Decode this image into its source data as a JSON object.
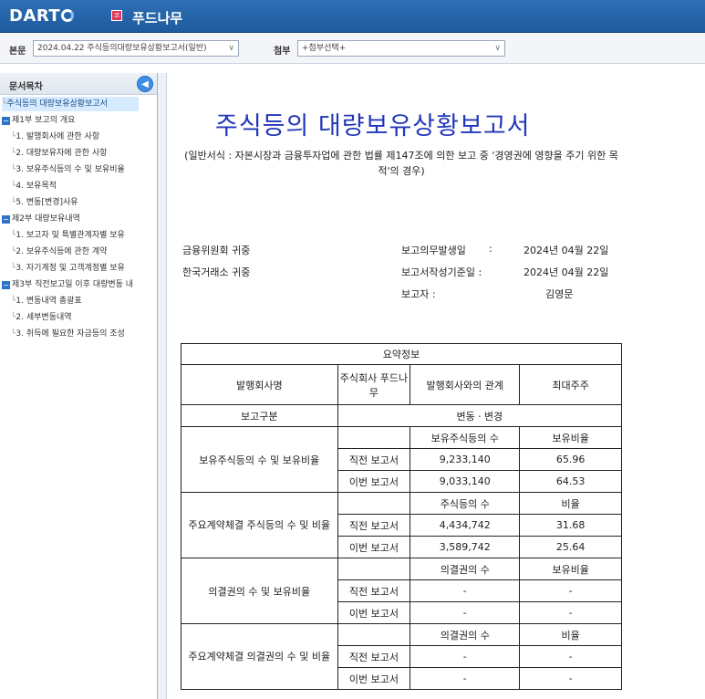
{
  "header": {
    "logo": "DART",
    "company_badge": "코",
    "company_name": "푸드나무"
  },
  "toolbar": {
    "main_label": "본문",
    "main_select": "2024.04.22  주식등의대량보유상황보고서(일반)",
    "attach_label": "첨부",
    "attach_select": "+첨부선택+"
  },
  "toc": {
    "title": "문서목차",
    "items": [
      {
        "label": "주식등의 대량보유상황보고서",
        "level": 0,
        "selected": true
      },
      {
        "label": "제1부 보고의 개요",
        "level": 0,
        "group": true
      },
      {
        "label": "1. 발행회사에 관한 사항",
        "level": 1
      },
      {
        "label": "2. 대량보유자에 관한 사항",
        "level": 1
      },
      {
        "label": "3. 보유주식등의 수 및 보유비율",
        "level": 1
      },
      {
        "label": "4. 보유목적",
        "level": 1
      },
      {
        "label": "5. 변동[변경]사유",
        "level": 1
      },
      {
        "label": "제2부 대량보유내역",
        "level": 0,
        "group": true
      },
      {
        "label": "1. 보고자 및 특별관계자별 보유",
        "level": 1
      },
      {
        "label": "2. 보유주식등에 관한 계약",
        "level": 1
      },
      {
        "label": "3. 자기계정 및 고객계정별 보유",
        "level": 1
      },
      {
        "label": "제3부 직전보고일 이후 대량변동 내",
        "level": 0,
        "group": true
      },
      {
        "label": "1. 변동내역 총괄표",
        "level": 1
      },
      {
        "label": "2. 세부변동내역",
        "level": 1
      },
      {
        "label": "3. 취득에 필요한 자금등의 조성",
        "level": 1
      }
    ]
  },
  "doc": {
    "title": "주식등의 대량보유상황보고서",
    "subtitle": "(일반서식 : 자본시장과 금융투자업에 관한 법률 제147조에 의한 보고 중 '경영권에 영향을 주기 위한 목적'의 경우)",
    "to1": "금융위원회 귀중",
    "to2": "한국거래소 귀중",
    "obligation_label": "보고의무발생일",
    "obligation_colon": ":",
    "obligation_date": "2024년 04월 22일",
    "basis_label": "보고서작성기준일 :",
    "basis_date": "2024년 04월 22일",
    "reporter_label": "보고자 :",
    "reporter_name": "김영문"
  },
  "summary": {
    "title": "요약정보",
    "issuer_label": "발행회사명",
    "issuer_name": "주식회사 푸드나무",
    "relation_label": "발행회사와의 관계",
    "relation_value": "최대주주",
    "report_type_label": "보고구분",
    "report_type_value": "변동ㆍ변경",
    "sections": [
      {
        "name": "보유주식등의 수 및 보유비율",
        "col1": "보유주식등의 수",
        "col2": "보유비율",
        "prev_label": "직전 보고서",
        "prev1": "9,233,140",
        "prev2": "65.96",
        "curr_label": "이번 보고서",
        "curr1": "9,033,140",
        "curr2": "64.53"
      },
      {
        "name": "주요계약체결 주식등의 수 및 비율",
        "col1": "주식등의 수",
        "col2": "비율",
        "prev_label": "직전 보고서",
        "prev1": "4,434,742",
        "prev2": "31.68",
        "curr_label": "이번 보고서",
        "curr1": "3,589,742",
        "curr2": "25.64"
      },
      {
        "name": "의결권의 수 및 보유비율",
        "col1": "의결권의 수",
        "col2": "보유비율",
        "prev_label": "직전 보고서",
        "prev1": "-",
        "prev2": "-",
        "curr_label": "이번 보고서",
        "curr1": "-",
        "curr2": "-"
      },
      {
        "name": "주요계약체결 의결권의 수 및 비율",
        "col1": "의결권의 수",
        "col2": "비율",
        "prev_label": "직전 보고서",
        "prev1": "-",
        "prev2": "-",
        "curr_label": "이번 보고서",
        "curr1": "-",
        "curr2": "-"
      }
    ]
  }
}
